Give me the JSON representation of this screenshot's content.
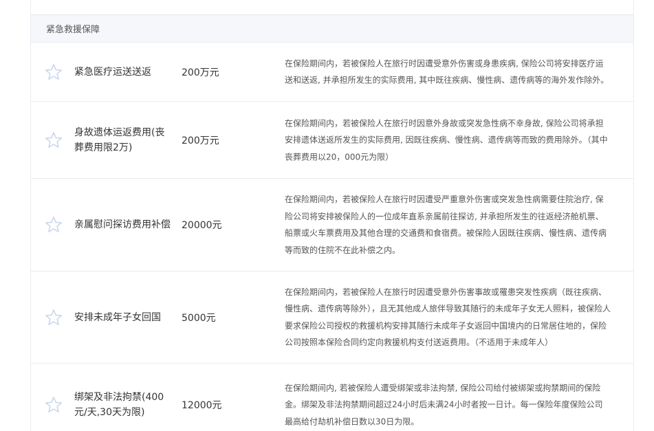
{
  "section": {
    "title": "紧急救援保障"
  },
  "colors": {
    "star_outline": "#c9d7ef",
    "header_bg": "#f5f7fa",
    "border": "#e9ecf1"
  },
  "rows": [
    {
      "icon": "star-outline-icon",
      "name": "紧急医疗运送送返",
      "amount": "200万元",
      "description": "在保险期间内，若被保险人在旅行时因遭受意外伤害或身患疾病, 保险公司将安排医疗运送和送返, 并承担所发生的实际费用, 其中既往疾病、慢性病、遗传病等的海外发作除外。"
    },
    {
      "icon": "star-outline-icon",
      "name": "身故遗体运返费用(丧葬费用限2万)",
      "amount": "200万元",
      "description": "在保险期间内，若被保险人在旅行时因意外身故或突发急性病不幸身故, 保险公司将承担安排遗体送返所发生的实际费用, 因既往疾病、慢性病、遗传病等而致的费用除外。（其中丧葬费用以20，000元为限）"
    },
    {
      "icon": "star-outline-icon",
      "name": "亲属慰问探访费用补偿",
      "amount": "20000元",
      "description": "在保险期间内，若被保险人在旅行时因遭受严重意外伤害或突发急性病需要住院治疗, 保险公司将安排被保险人的一位成年直系亲属前往探访, 并承担所发生的往返经济舱机票、船票或火车票费用及其他合理的交通费和食宿费。被保险人因既往疾病、慢性病、遗传病等而致的住院不在此补偿之内。"
    },
    {
      "icon": "star-outline-icon",
      "name": "安排未成年子女回国",
      "amount": "5000元",
      "description": "在保险期间内，若被保险人在旅行时因遭受意外伤害事故或罹患突发性疾病（既往疾病、慢性病、遗传病等除外），且无其他成人旅伴导致其随行的未成年子女无人照料，被保险人要求保险公司授权的救援机构安排其随行未成年子女返回中国境内的日常居住地的，保险公司按照本保险合同约定向救援机构支付送返费用。（不适用于未成年人）"
    },
    {
      "icon": "star-outline-icon",
      "name": "绑架及非法拘禁(400元/天,30天为限)",
      "amount": "12000元",
      "description": "在保险期间内, 若被保险人遭受绑架或非法拘禁, 保险公司给付被绑架或拘禁期间的保险金。绑架及非法拘禁期间超过24小时后未满24小时者按一日计。每一保险年度保险公司最高给付劫机补偿日数以30日为限。"
    }
  ]
}
